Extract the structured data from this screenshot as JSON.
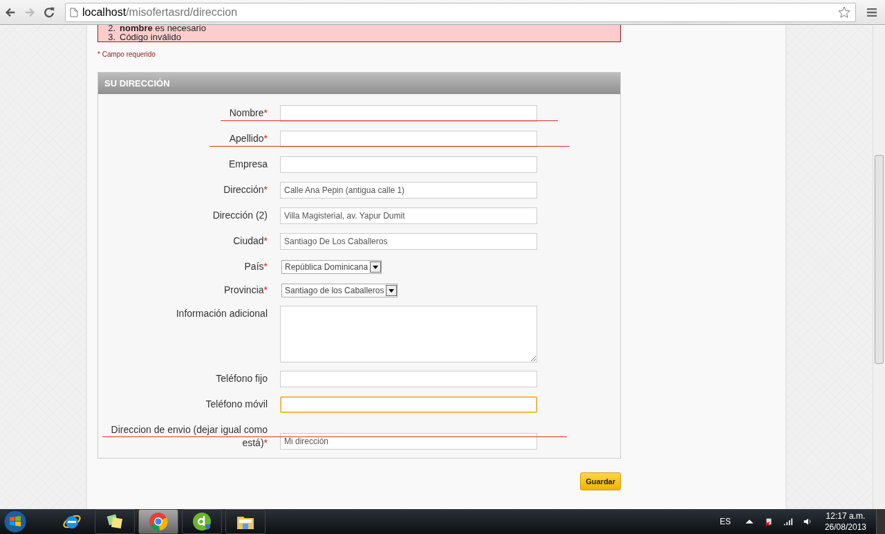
{
  "browser": {
    "url_host": "localhost",
    "url_path": "/misofertasrd/direccion"
  },
  "errors": [
    {
      "number": "2.",
      "text": "**nombre** es necesario"
    },
    {
      "number": "3.",
      "text": "Código inválido"
    }
  ],
  "required_note": "* Campo requerido",
  "section": {
    "title": "SU DIRECCIÓN"
  },
  "fields": [
    {
      "label": "Nombre",
      "kind": "text",
      "required_mark": "*",
      "struck": true,
      "focused": false
    },
    {
      "label": "Apellido",
      "kind": "text",
      "required_mark": "*",
      "struck": true,
      "focused": false
    },
    {
      "label": "Empresa",
      "kind": "text",
      "struck": false,
      "focused": false
    },
    {
      "label": "Dirección",
      "kind": "text",
      "required_mark": "*",
      "value": "Calle Ana Pepin (antigua calle 1)",
      "struck": false,
      "focused": false
    },
    {
      "label": "Dirección (2)",
      "kind": "text",
      "value": "Villa Magisterial, av. Yapur Dumit",
      "struck": false,
      "focused": false
    },
    {
      "label": "Ciudad",
      "kind": "text",
      "required_mark": "*",
      "value": "Santiago De Los Caballeros",
      "struck": false,
      "focused": false
    },
    {
      "label": "País",
      "kind": "select",
      "required_mark": "*",
      "value": "República Dominicana",
      "struck": false,
      "focused": false
    },
    {
      "label": "Provincia",
      "kind": "select",
      "required_mark": "*",
      "value": "Santiago de los Caballeros",
      "struck": false,
      "focused": false
    },
    {
      "label": "Información adicional",
      "kind": "textarea",
      "struck": false,
      "focused": false
    },
    {
      "label": "Teléfono fijo",
      "kind": "text",
      "struck": false,
      "focused": false
    },
    {
      "label": "Teléfono móvil",
      "kind": "text",
      "struck": false,
      "focused": true
    },
    {
      "label": "Direccion de envio (dejar igual como está)",
      "kind": "text",
      "required_mark": "*",
      "value": "Mi dirección",
      "struck": true,
      "focused": false
    }
  ],
  "save_button": "Guardar",
  "taskbar": {
    "apps": [
      {
        "kind": "ie",
        "selected": false
      },
      {
        "kind": "notes",
        "selected": false
      },
      {
        "kind": "chrome",
        "selected": true
      },
      {
        "kind": "dw",
        "selected": false
      },
      {
        "kind": "folder",
        "selected": false
      }
    ],
    "language": "ES",
    "time": "12:17 a.m.",
    "date": "26/08/2013"
  }
}
